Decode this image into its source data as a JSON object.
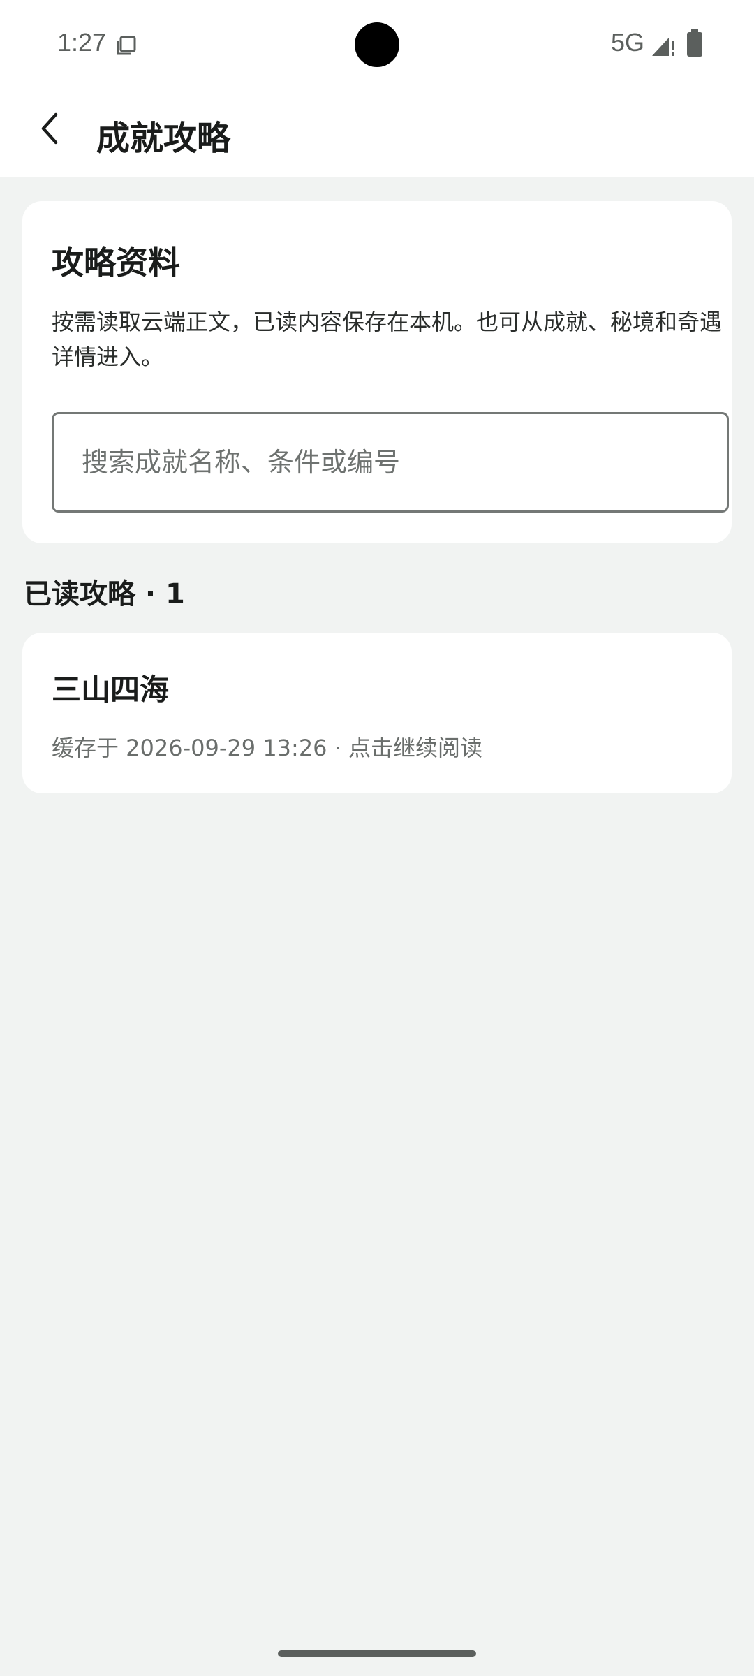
{
  "status_bar": {
    "time": "1:27",
    "network": "5G",
    "icons": [
      "screen-record-icon",
      "signal-icon",
      "battery-icon"
    ]
  },
  "app_bar": {
    "title": "成就攻略",
    "back_icon": "arrow-back-icon"
  },
  "info_card": {
    "heading": "攻略资料",
    "description": "按需读取云端正文，已读内容保存在本机。也可从成就、秘境和奇遇详情进入。",
    "search": {
      "placeholder": "搜索成就名称、条件或编号",
      "value": ""
    }
  },
  "read_section": {
    "title": "已读攻略 · 1",
    "items": [
      {
        "title": "三山四海",
        "meta": "缓存于 2026-09-29 13:26 · 点击继续阅读"
      }
    ]
  },
  "colors": {
    "background": "#f1f3f2",
    "surface": "#ffffff",
    "text_primary": "#1a1c1b",
    "text_secondary": "#6a6e6c",
    "outline": "#747876"
  }
}
